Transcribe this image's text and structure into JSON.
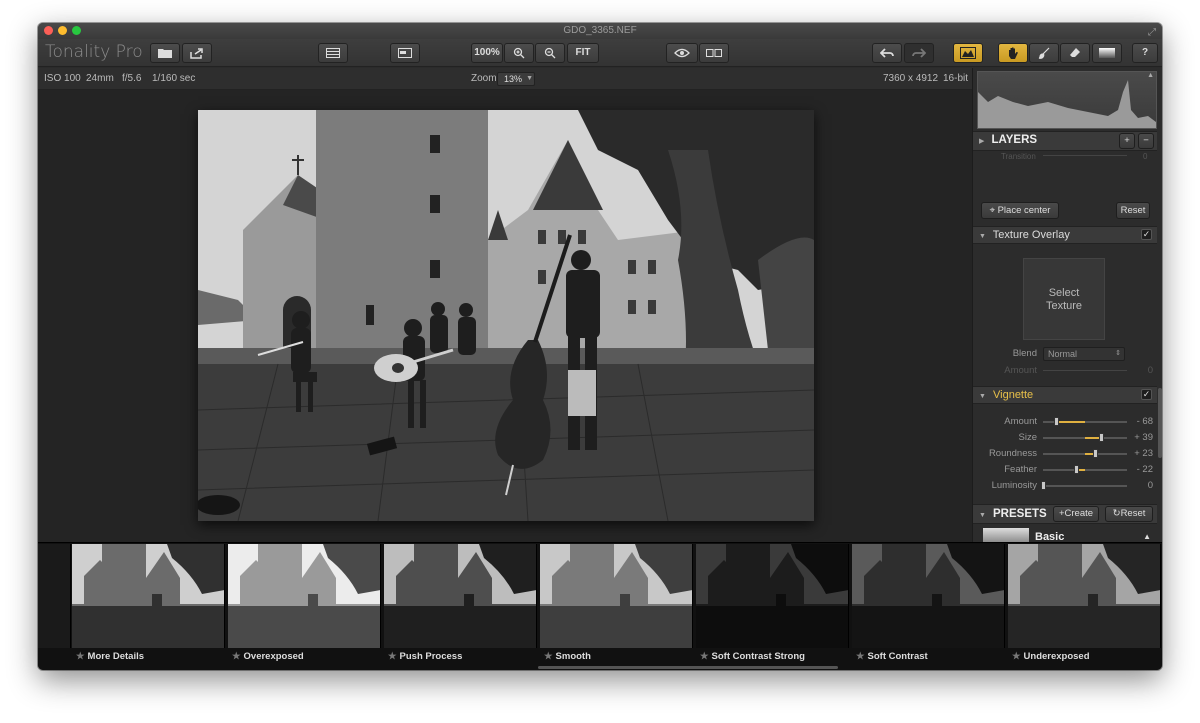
{
  "window": {
    "title": "GDO_3365.NEF"
  },
  "app": {
    "name": "Tonality Pro"
  },
  "toolbar": {
    "zoom_100": "100%",
    "fit": "FIT",
    "help": "?"
  },
  "info": {
    "iso": "ISO 100",
    "focal": "24mm",
    "aperture": "f/5.6",
    "shutter": "1/160 sec",
    "zoom_label": "Zoom",
    "zoom_value": "13%",
    "dimensions": "7360 x 4912",
    "bit_depth": "16-bit"
  },
  "panel": {
    "layers": {
      "title": "LAYERS",
      "add": "+",
      "remove": "−",
      "cut_label": "Transition",
      "cut_value": "0"
    },
    "place_center": "Place center",
    "reset": "Reset",
    "texture": {
      "title": "Texture Overlay",
      "checked": "✓",
      "select_line1": "Select",
      "select_line2": "Texture",
      "blend_label": "Blend",
      "blend_value": "Normal",
      "amount_label": "Amount",
      "amount_value": "0"
    },
    "vignette": {
      "title": "Vignette",
      "checked": "✓",
      "rows": [
        {
          "label": "Amount",
          "value": "- 68",
          "level": -0.68
        },
        {
          "label": "Size",
          "value": "+ 39",
          "level": 0.39
        },
        {
          "label": "Roundness",
          "value": "+ 23",
          "level": 0.23
        },
        {
          "label": "Feather",
          "value": "- 22",
          "level": -0.22
        },
        {
          "label": "Luminosity",
          "value": "0",
          "level": 0
        }
      ]
    },
    "presets": {
      "title": "PRESETS",
      "create": "Create",
      "reset": "Reset",
      "current": "Basic"
    }
  },
  "filmstrip": [
    {
      "label": "More Details"
    },
    {
      "label": "Overexposed"
    },
    {
      "label": "Push Process"
    },
    {
      "label": "Smooth"
    },
    {
      "label": "Soft Contrast Strong"
    },
    {
      "label": "Soft Contrast"
    },
    {
      "label": "Underexposed"
    }
  ],
  "colors": {
    "accent": "#e0b040",
    "vignette_title": "#e8c04a"
  }
}
